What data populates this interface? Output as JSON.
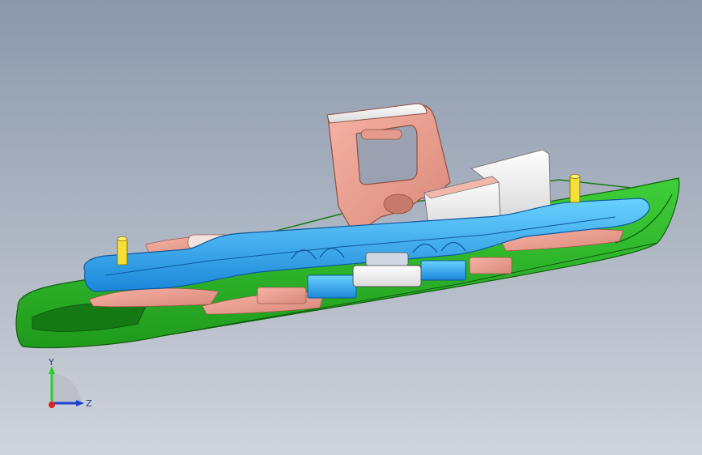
{
  "view": {
    "axes": {
      "y_label": "Y",
      "z_label": "Z"
    }
  }
}
